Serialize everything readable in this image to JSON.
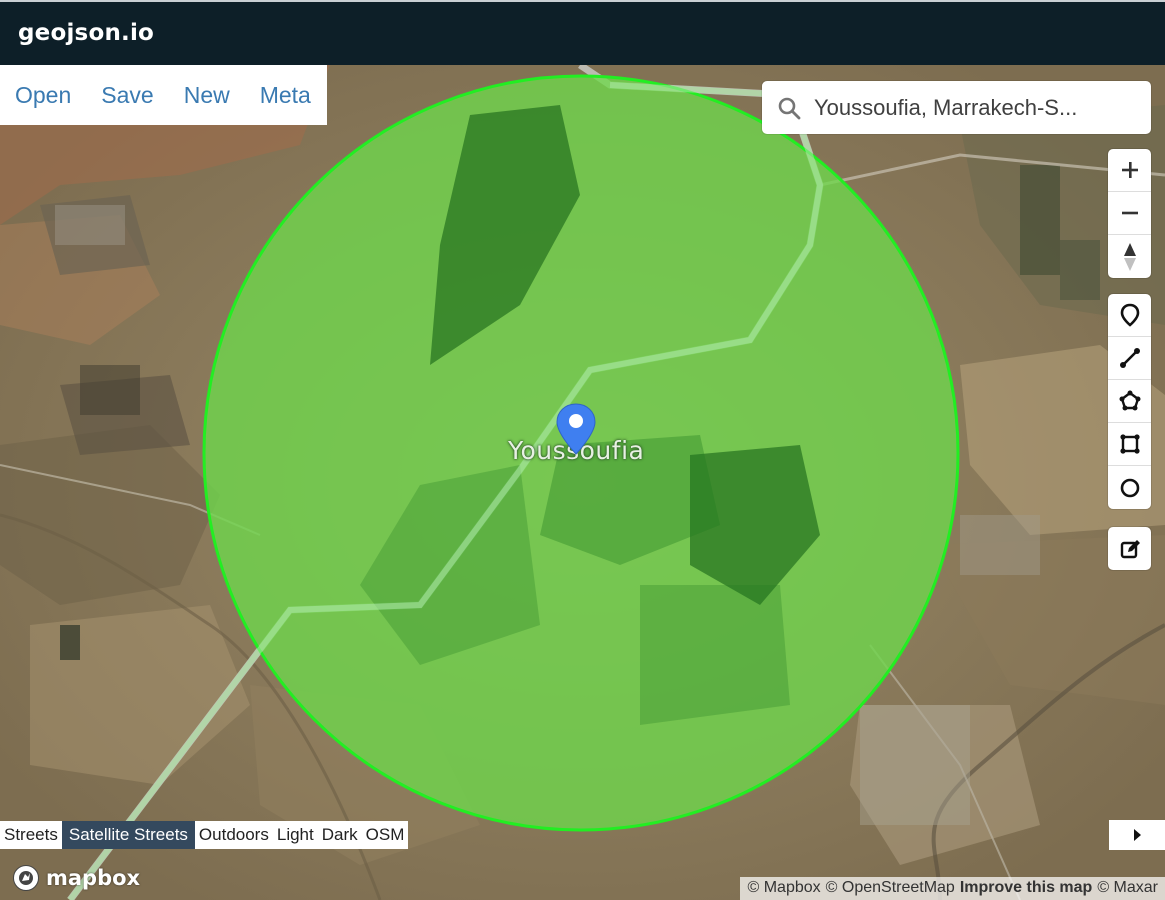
{
  "app": {
    "title": "geojson.io"
  },
  "file_menu": {
    "open": "Open",
    "save": "Save",
    "new": "New",
    "meta": "Meta"
  },
  "search": {
    "value": "Youssoufia, Marrakech-S...",
    "icon": "search-icon"
  },
  "map": {
    "place_label": "Youssoufia",
    "marker_color": "#3f7ff0",
    "circle_fill": "#6ed84c",
    "circle_stroke": "#22ee22"
  },
  "controls": {
    "zoom_in": "plus-icon",
    "zoom_out": "minus-icon",
    "compass": "compass-icon",
    "draw_point": "marker-icon",
    "draw_line": "line-icon",
    "draw_polygon": "polygon-icon",
    "draw_rectangle": "rectangle-icon",
    "draw_circle": "circle-icon",
    "edit": "edit-icon"
  },
  "layers": {
    "items": [
      "Streets",
      "Satellite Streets",
      "Outdoors",
      "Light",
      "Dark",
      "OSM"
    ],
    "active": "Satellite Streets"
  },
  "footer": {
    "logo": "mapbox",
    "attribution": [
      "© Mapbox",
      "© OpenStreetMap",
      "Improve this map",
      "© Maxar"
    ]
  }
}
